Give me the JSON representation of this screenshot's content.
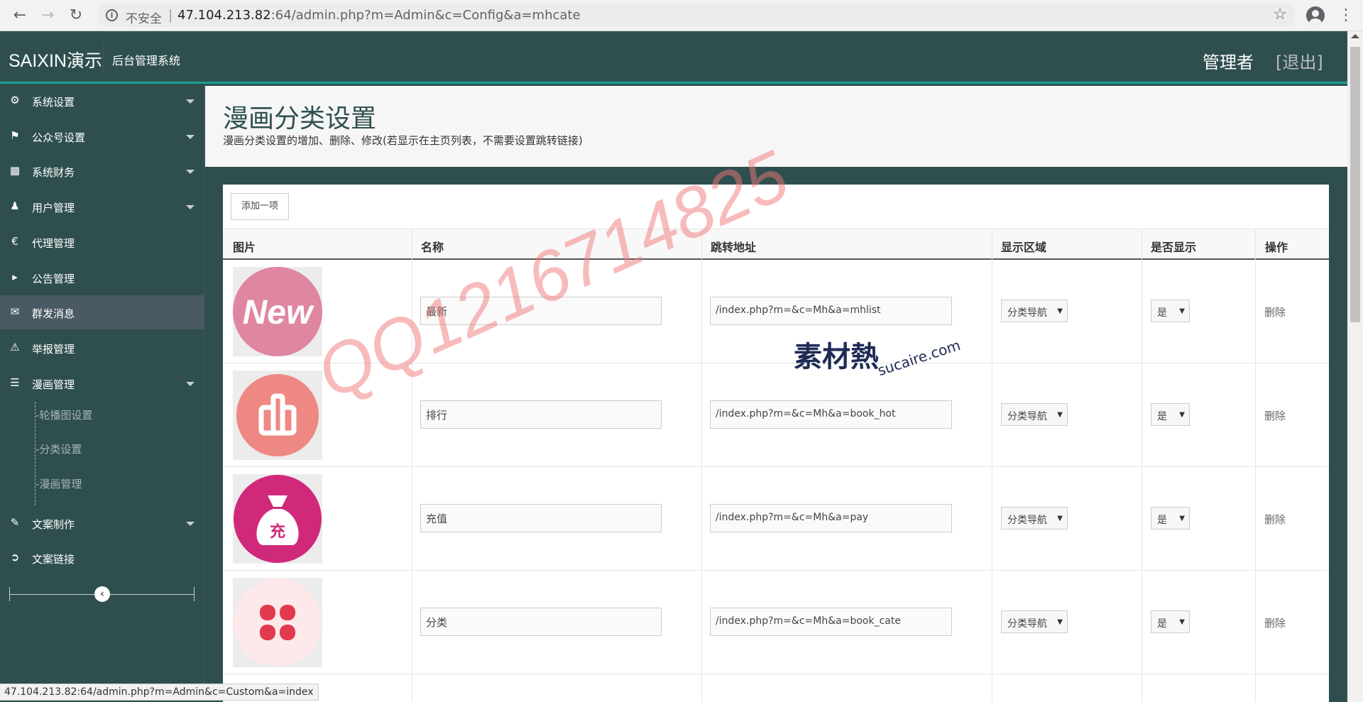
{
  "browser": {
    "security_label": "不安全",
    "url_host": "47.104.213.82",
    "url_rest": ":64/admin.php?m=Admin&c=Config&a=mhcate",
    "status_url": "47.104.213.82:64/admin.php?m=Admin&c=Custom&a=index"
  },
  "header": {
    "brand": "SAIXIN演示",
    "subtitle": "后台管理系统",
    "user": "管理者",
    "logout": "[退出]"
  },
  "sidebar": {
    "items": [
      {
        "label": "系统设置",
        "icon": "gear-icon"
      },
      {
        "label": "公众号设置",
        "icon": "tags-icon"
      },
      {
        "label": "系统财务",
        "icon": "bar-chart-icon"
      },
      {
        "label": "用户管理",
        "icon": "user-icon"
      },
      {
        "label": "代理管理",
        "icon": "euro-icon"
      },
      {
        "label": "公告管理",
        "icon": "bullhorn-icon"
      },
      {
        "label": "群发消息",
        "icon": "envelope-icon"
      },
      {
        "label": "举报管理",
        "icon": "warning-icon"
      },
      {
        "label": "漫画管理",
        "icon": "list-icon"
      },
      {
        "label": "文案制作",
        "icon": "edit-icon"
      },
      {
        "label": "文案链接",
        "icon": "share-icon"
      }
    ],
    "sub_items": [
      "-轮播图设置",
      "-分类设置",
      "-漫画管理"
    ]
  },
  "page": {
    "title": "漫画分类设置",
    "description": "漫画分类设置的增加、删除、修改(若显示在主页列表，不需要设置跳转链接)"
  },
  "table": {
    "add_button": "添加一项",
    "headers": [
      "图片",
      "名称",
      "跳转地址",
      "显示区域",
      "是否显示",
      "操作"
    ],
    "rows": [
      {
        "name": "最新",
        "url": "/index.php?m=&c=Mh&a=mhlist",
        "region": "分类导航",
        "show": "是",
        "action": "删除",
        "icon_text": "New"
      },
      {
        "name": "排行",
        "url": "/index.php?m=&c=Mh&a=book_hot",
        "region": "分类导航",
        "show": "是",
        "action": "删除",
        "icon_text": ""
      },
      {
        "name": "充值",
        "url": "/index.php?m=&c=Mh&a=pay",
        "region": "分类导航",
        "show": "是",
        "action": "删除",
        "icon_text": "充"
      },
      {
        "name": "分类",
        "url": "/index.php?m=&c=Mh&a=book_cate",
        "region": "分类导航",
        "show": "是",
        "action": "删除",
        "icon_text": ""
      }
    ]
  },
  "watermark": {
    "qq": "QQ1216714825",
    "logo": "素材熱",
    "logo_sub": "sucaire.com"
  },
  "colors": {
    "sidebar_bg": "#2f4f4f",
    "accent": "#1aa094",
    "active_item": "#4a5a64"
  }
}
